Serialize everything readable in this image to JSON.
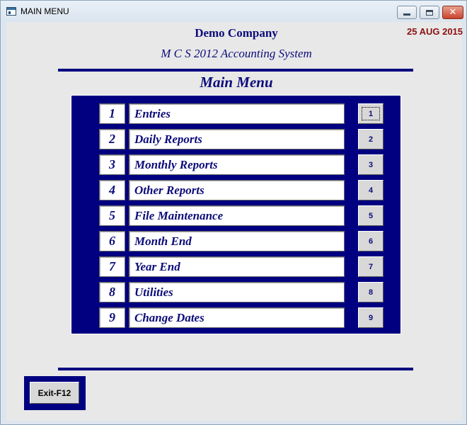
{
  "window": {
    "title": "MAIN MENU",
    "icon": "app-window-icon",
    "controls": {
      "minimize": "minimize-icon",
      "maximize": "maximize-icon",
      "close": "close-icon"
    }
  },
  "header": {
    "company": "Demo Company",
    "system": "M C S 2012 Accounting System",
    "date": "25 AUG 2015"
  },
  "menu": {
    "heading": "Main Menu",
    "items": [
      {
        "num": "1",
        "label": "Entries",
        "button": "1"
      },
      {
        "num": "2",
        "label": "Daily Reports",
        "button": "2"
      },
      {
        "num": "3",
        "label": "Monthly Reports",
        "button": "3"
      },
      {
        "num": "4",
        "label": "Other Reports",
        "button": "4"
      },
      {
        "num": "5",
        "label": "File Maintenance",
        "button": "5"
      },
      {
        "num": "6",
        "label": "Month End",
        "button": "6"
      },
      {
        "num": "7",
        "label": "Year End",
        "button": "7"
      },
      {
        "num": "8",
        "label": "Utilities",
        "button": "8"
      },
      {
        "num": "9",
        "label": "Change Dates",
        "button": "9"
      }
    ]
  },
  "footer": {
    "exit_label": "Exit-F12"
  },
  "colors": {
    "navy": "#000080",
    "text_blue": "#0c0c7a",
    "date_red": "#8b1010",
    "background": "#e8e8e8"
  }
}
